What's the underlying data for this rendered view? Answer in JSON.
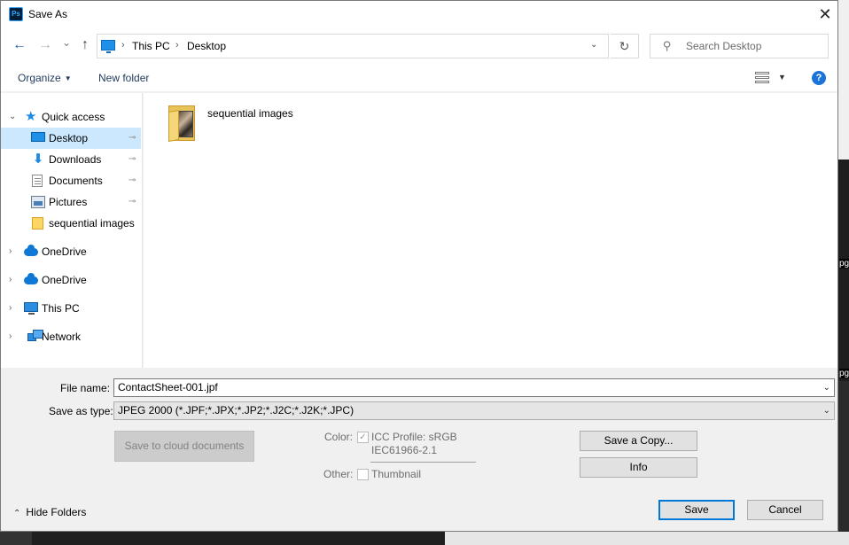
{
  "window": {
    "title": "Save As",
    "app_icon_text": "Ps",
    "close_glyph": "✕"
  },
  "nav": {
    "back_glyph": "←",
    "forward_glyph": "→",
    "recent_glyph": "⌄",
    "up_glyph": "↑",
    "breadcrumbs": [
      "This PC",
      "Desktop"
    ],
    "breadcrumb_sep": "›",
    "address_dropdown_glyph": "⌄",
    "refresh_glyph": "↻",
    "search_placeholder": "Search Desktop"
  },
  "toolbar": {
    "organize_label": "Organize",
    "new_folder_label": "New folder",
    "help_label": "?"
  },
  "sidebar": {
    "items": [
      {
        "label": "Quick access",
        "icon": "star-icon",
        "expanded": true
      },
      {
        "label": "Desktop",
        "icon": "desktop-icon",
        "pinned": true,
        "selected": true
      },
      {
        "label": "Downloads",
        "icon": "download-icon",
        "pinned": true
      },
      {
        "label": "Documents",
        "icon": "document-icon",
        "pinned": true
      },
      {
        "label": "Pictures",
        "icon": "pictures-icon",
        "pinned": true
      },
      {
        "label": "sequential images",
        "icon": "folder-icon"
      },
      {
        "label": "OneDrive",
        "icon": "cloud-icon"
      },
      {
        "label": "OneDrive",
        "icon": "cloud-icon"
      },
      {
        "label": "This PC",
        "icon": "computer-icon"
      },
      {
        "label": "Network",
        "icon": "network-icon"
      }
    ],
    "pin_glyph": "📌",
    "collapse_glyph": "⌄",
    "expand_glyph": "›"
  },
  "files": [
    {
      "name": "sequential images",
      "icon": "folder-icon"
    }
  ],
  "form": {
    "file_name_label": "File name:",
    "file_name_value": "ContactSheet-001.jpf",
    "save_as_type_label": "Save as type:",
    "save_as_type_value": "JPEG 2000 (*.JPF;*.JPX;*.JP2;*.J2C;*.J2K;*.JPC)",
    "dropdown_glyph": "⌄"
  },
  "options": {
    "save_cloud_label": "Save to cloud documents",
    "color_label": "Color:",
    "icc_profile_label": "ICC Profile:  sRGB",
    "icc_profile_line2": "IEC61966-2.1",
    "icc_checked": true,
    "other_label": "Other:",
    "thumbnail_label": "Thumbnail",
    "thumbnail_checked": false,
    "save_copy_label": "Save a Copy...",
    "info_label": "Info"
  },
  "footer": {
    "hide_folders_label": "Hide Folders",
    "save_label": "Save",
    "cancel_label": "Cancel"
  },
  "background": {
    "right_edge_labels": [
      "pg",
      "pg"
    ]
  }
}
